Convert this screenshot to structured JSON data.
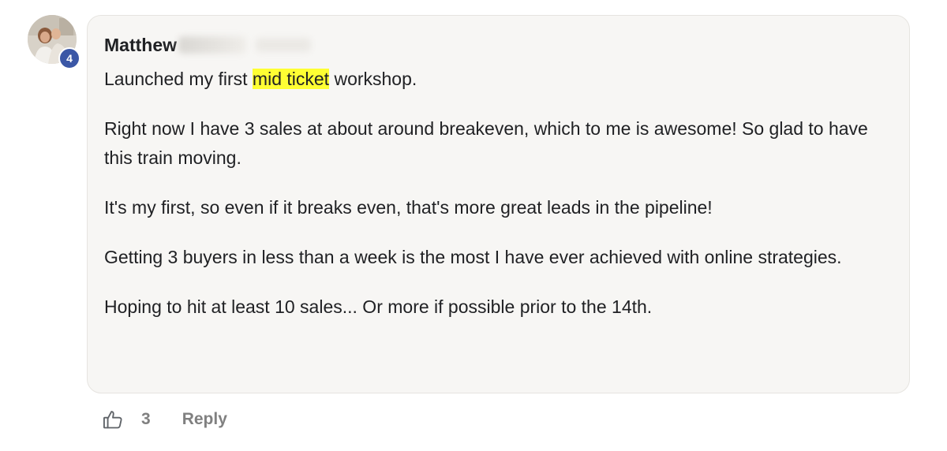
{
  "comment": {
    "author": "Matthew",
    "author_level": "4",
    "paragraphs": [
      {
        "before": "Launched my first ",
        "highlight": "mid ticket",
        "after": " workshop."
      },
      {
        "text": "Right now I have 3 sales at about around breakeven, which to me is awesome! So glad to have this train moving."
      },
      {
        "text": "It's my first, so even if it breaks even, that's more great leads in the pipeline!"
      },
      {
        "text": "Getting 3 buyers in less than a week is the most I have ever achieved with online strategies."
      },
      {
        "text": "Hoping to hit at least 10 sales... Or more if possible prior to the 14th."
      }
    ]
  },
  "actions": {
    "like_icon": "thumbs-up-icon",
    "like_count": "3",
    "reply_label": "Reply"
  },
  "colors": {
    "bubble_bg": "#f7f6f4",
    "highlight": "#ffff33",
    "badge": "#3b57a6",
    "muted_text": "#808080"
  }
}
